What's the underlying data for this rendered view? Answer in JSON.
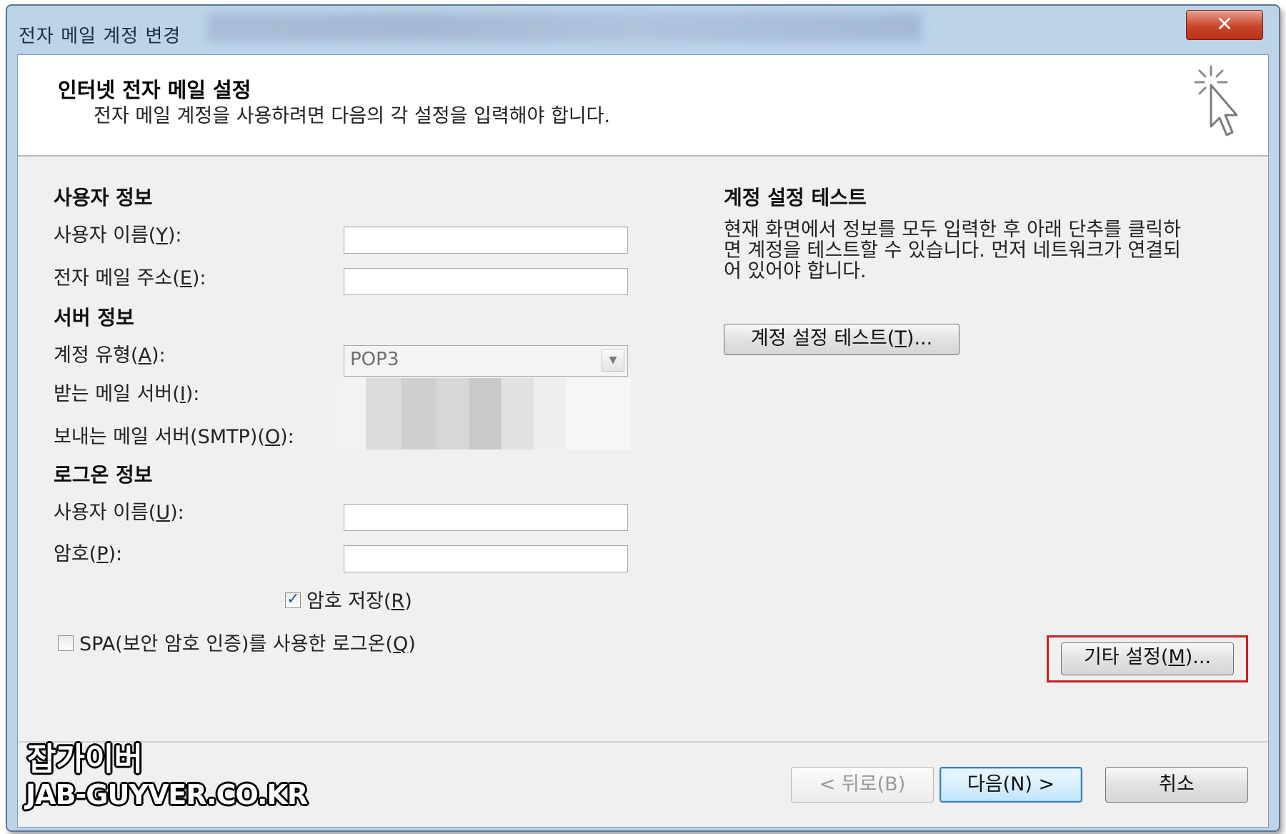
{
  "window": {
    "title": "전자 메일 계정 변경",
    "close_glyph": "✕"
  },
  "header": {
    "title": "인터넷 전자 메일 설정",
    "description": "전자 메일 계정을 사용하려면 다음의 각 설정을 입력해야 합니다."
  },
  "user_info": {
    "section": "사용자 정보",
    "name_label": "사용자 이름(",
    "name_key": "Y",
    "name_suffix": "):",
    "email_label": "전자 메일 주소(",
    "email_key": "E",
    "email_suffix": "):"
  },
  "server_info": {
    "section": "서버 정보",
    "account_type_label": "계정 유형(",
    "account_type_key": "A",
    "account_type_suffix": "):",
    "account_type_value": "POP3",
    "incoming_label": "받는 메일 서버(",
    "incoming_key": "I",
    "incoming_suffix": "):",
    "outgoing_label": "보내는 메일 서버(SMTP)(",
    "outgoing_key": "O",
    "outgoing_suffix": "):"
  },
  "logon_info": {
    "section": "로그온 정보",
    "username_label": "사용자 이름(",
    "username_key": "U",
    "username_suffix": "):",
    "password_label": "암호(",
    "password_key": "P",
    "password_suffix": "):",
    "remember_password": "암호 저장(",
    "remember_key": "R",
    "remember_suffix": ")",
    "spa_label": "SPA(보안 암호 인증)를 사용한 로그온(",
    "spa_key": "Q",
    "spa_suffix": ")"
  },
  "test": {
    "section": "계정 설정 테스트",
    "desc_line1": "현재 화면에서 정보를 모두 입력한 후 아래 단추를 클릭하",
    "desc_line2": "면 계정을 테스트할 수 있습니다. 먼저 네트워크가 연결되",
    "desc_line3": "어 있어야 합니다.",
    "button_prefix": "계정 설정 테스트(",
    "button_key": "T",
    "button_suffix": ")..."
  },
  "more_settings": {
    "prefix": "기타 설정(",
    "key": "M",
    "suffix": ")..."
  },
  "footer": {
    "back": "< 뒤로(B)",
    "next": "다음(N) >",
    "cancel": "취소"
  },
  "watermark": {
    "line1": "잡가이버",
    "line2": "JAB-GUYVER.CO.KR"
  },
  "colors": {
    "highlight": "#cc1f1f",
    "default_button_border": "#3c7fb1",
    "close_button": "#c8442b"
  }
}
